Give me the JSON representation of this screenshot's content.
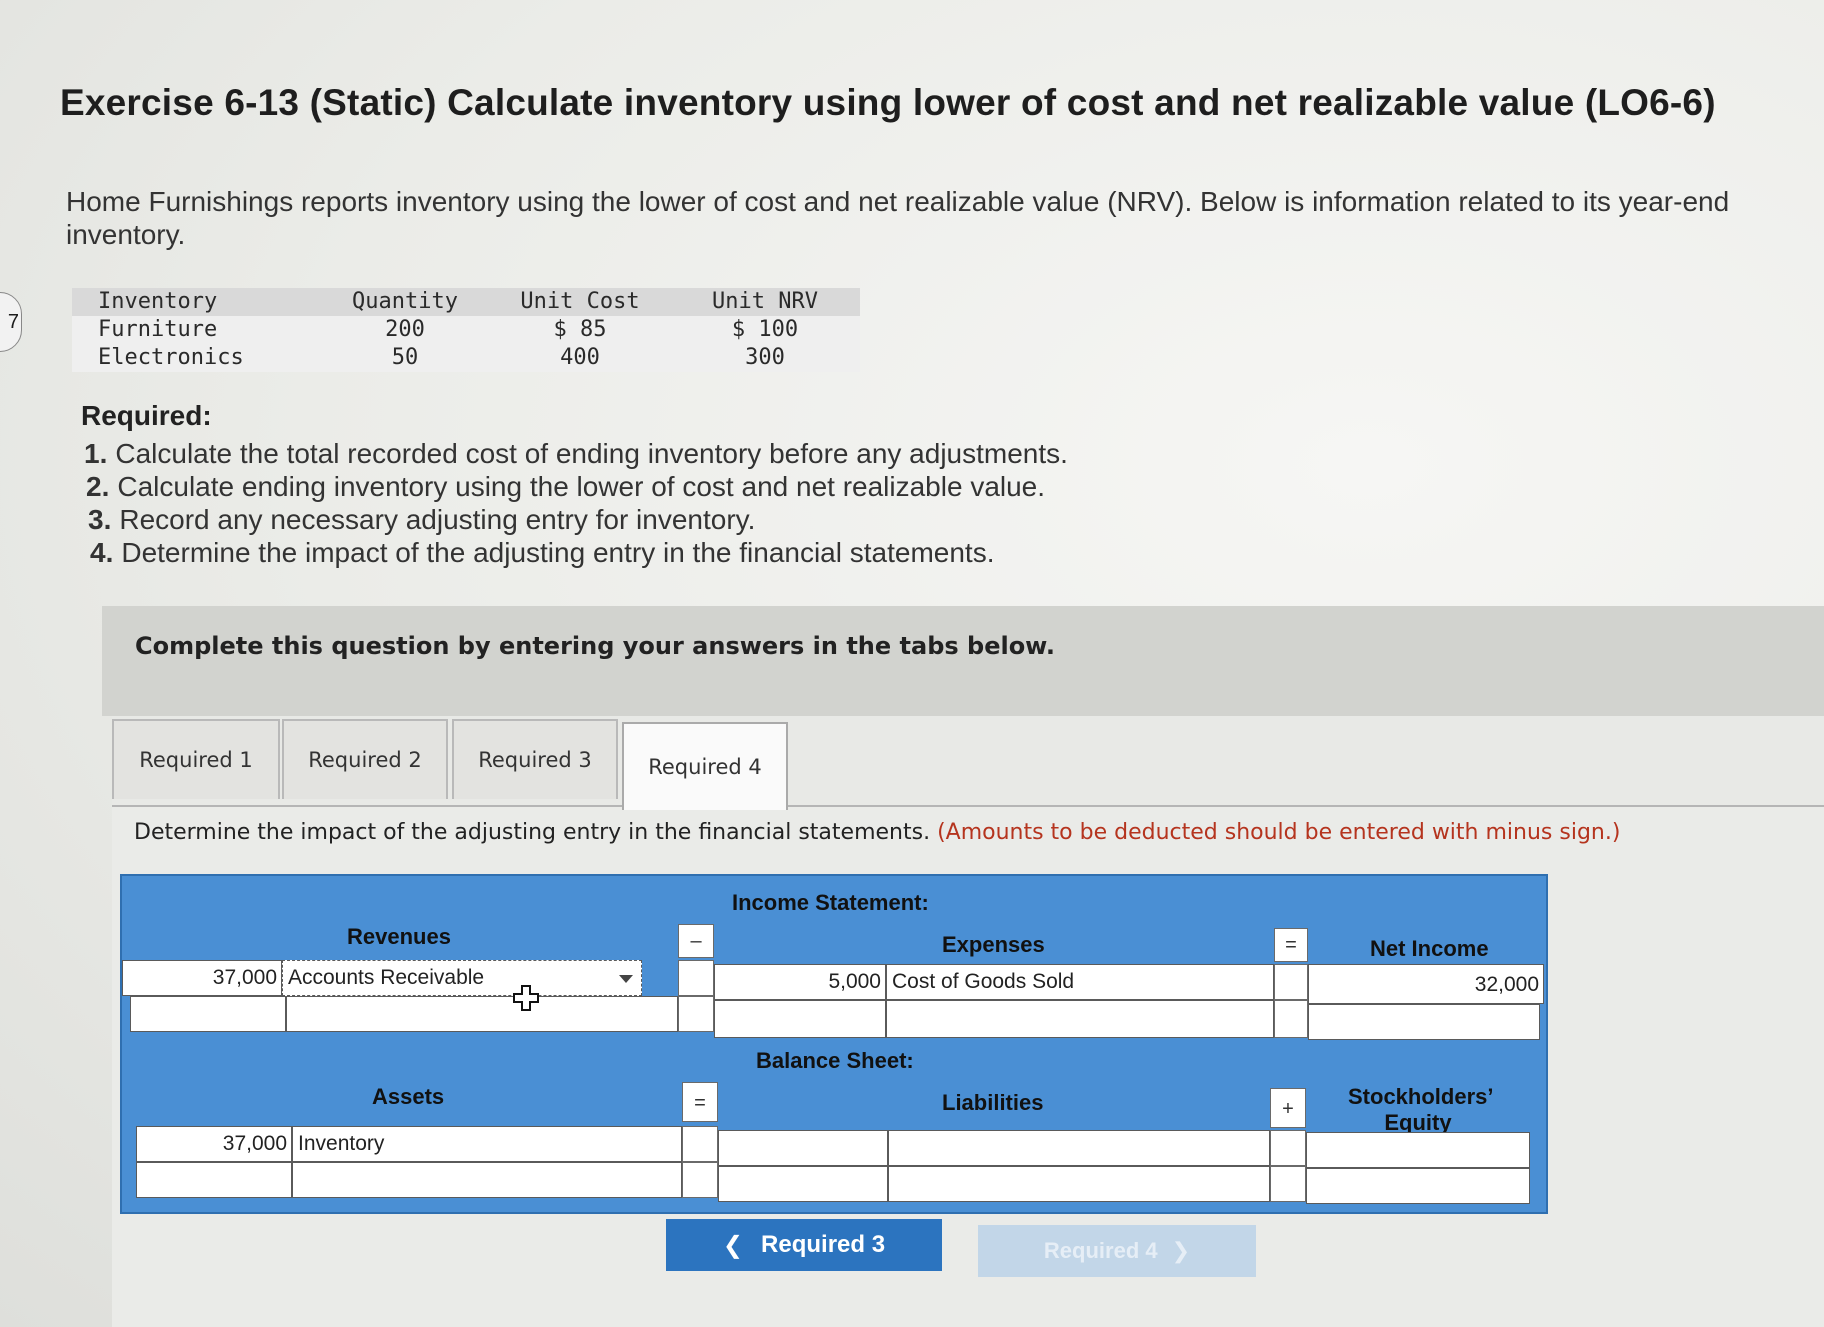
{
  "side_marker": "7",
  "title": "Exercise 6-13 (Static) Calculate inventory using lower of cost and net realizable value (LO6-6)",
  "intro": "Home Furnishings reports inventory using the lower of cost and net realizable value (NRV). Below is information related to its year-end inventory.",
  "inventory_table": {
    "headers": [
      "Inventory",
      "Quantity",
      "Unit Cost",
      "Unit NRV"
    ],
    "rows": [
      [
        "Furniture",
        "200",
        "$ 85",
        "$ 100"
      ],
      [
        "Electronics",
        "50",
        "400",
        "300"
      ]
    ]
  },
  "required": {
    "heading": "Required:",
    "items": [
      {
        "num": "1.",
        "text": "Calculate the total recorded cost of ending inventory before any adjustments."
      },
      {
        "num": "2.",
        "text": "Calculate ending inventory using the lower of cost and net realizable value."
      },
      {
        "num": "3.",
        "text": "Record any necessary adjusting entry for inventory."
      },
      {
        "num": "4.",
        "text": "Determine the impact of the adjusting entry in the financial statements."
      }
    ]
  },
  "prompt": "Complete this question by entering your answers in the tabs below.",
  "tabs": [
    "Required 1",
    "Required 2",
    "Required 3",
    "Required 4"
  ],
  "active_tab": "Required 4",
  "instructions": {
    "main": "Determine the impact of the adjusting entry in the financial statements.",
    "note": "(Amounts to be deducted should be entered with minus sign.)"
  },
  "income_statement": {
    "label": "Income Statement:",
    "revenues_label": "Revenues",
    "minus": "–",
    "expenses_label": "Expenses",
    "equals": "=",
    "net_income_label": "Net Income",
    "revenue_amount": "37,000",
    "revenue_account": "Accounts Receivable",
    "expense_amount": "5,000",
    "expense_account": "Cost of Goods Sold",
    "net_income_amount": "32,000"
  },
  "balance_sheet": {
    "label": "Balance Sheet:",
    "assets_label": "Assets",
    "equals": "=",
    "liabilities_label": "Liabilities",
    "plus": "+",
    "equity_label_1": "Stockholders’",
    "equity_label_2": "Equity",
    "asset_amount": "37,000",
    "asset_account": "Inventory"
  },
  "nav": {
    "prev_label": "Required 3",
    "next_label": "Required 4",
    "prev_icon": "chevron-left-icon",
    "next_icon": "chevron-right-icon"
  },
  "colors": {
    "grid_blue": "#4a8fd4",
    "button_blue": "#2c74bf",
    "note_red": "#b5341e"
  }
}
